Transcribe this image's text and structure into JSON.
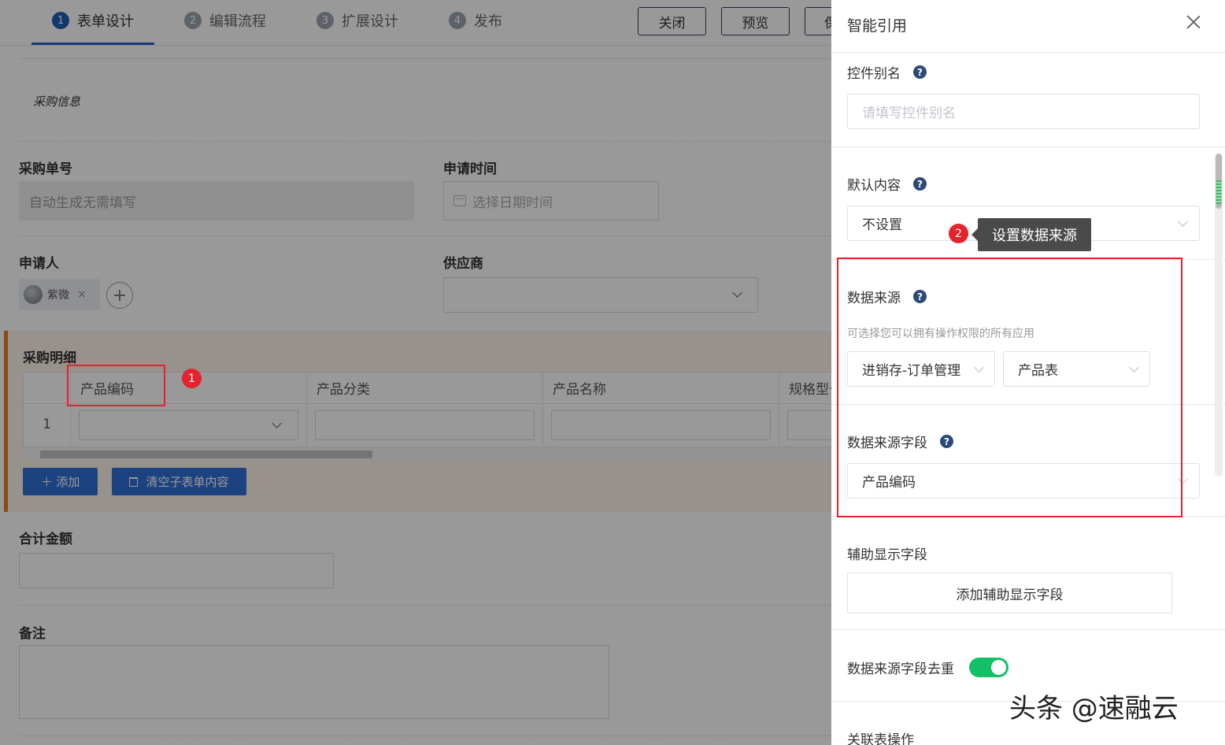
{
  "steps": [
    {
      "num": "1",
      "label": "表单设计"
    },
    {
      "num": "2",
      "label": "编辑流程"
    },
    {
      "num": "3",
      "label": "扩展设计"
    },
    {
      "num": "4",
      "label": "发布"
    }
  ],
  "toolbar": {
    "close_label": "关闭",
    "preview_label": "预览",
    "save_label": "保"
  },
  "form": {
    "section_title": "采购信息",
    "order_no": {
      "label": "采购单号",
      "value": "自动生成无需填写"
    },
    "apply_time": {
      "label": "申请时间",
      "placeholder": "选择日期时间"
    },
    "applicant": {
      "label": "申请人",
      "user_name": "紫微",
      "remove": "×",
      "add": "+"
    },
    "supplier": {
      "label": "供应商",
      "value": ""
    },
    "detail": {
      "title": "采购明细",
      "columns": [
        "产品编码",
        "产品分类",
        "产品名称",
        "规格型号"
      ],
      "row_index": "1",
      "add_button": "＋ 添加",
      "clear_button": "清空子表单内容"
    },
    "total": {
      "label": "合计金额",
      "value": ""
    },
    "remark": {
      "label": "备注",
      "value": ""
    }
  },
  "panel": {
    "title": "智能引用",
    "alias": {
      "label": "控件别名",
      "placeholder": "请填写控件别名"
    },
    "default_content": {
      "label": "默认内容",
      "value": "不设置"
    },
    "data_source": {
      "label": "数据来源",
      "hint": "可选择您可以拥有操作权限的所有应用",
      "app": "进销存-订单管理",
      "table": "产品表"
    },
    "source_field": {
      "label": "数据来源字段",
      "value": "产品编码"
    },
    "aux_field": {
      "label": "辅助显示字段",
      "button": "添加辅助显示字段"
    },
    "dedupe": {
      "label": "数据来源字段去重",
      "enabled": true
    },
    "related_ops": {
      "label": "关联表操作"
    },
    "help_glyph": "?"
  },
  "annotations": {
    "badge1": "1",
    "badge2": "2",
    "tooltip": "设置数据来源"
  },
  "watermark": "头条 @速融云",
  "colors": {
    "accent": "#2f6fd6",
    "highlight": "#e5232e",
    "toggle_on": "#13c065",
    "subform_stripe": "#e67e22"
  }
}
